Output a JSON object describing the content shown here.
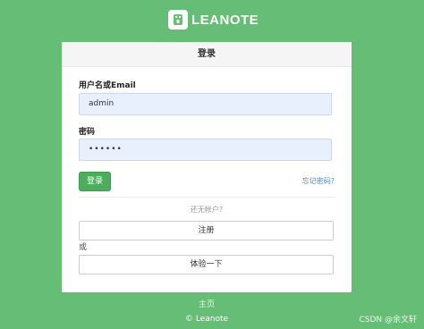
{
  "brand": {
    "logo_text": "LEANOTE",
    "logo_icon": "leanote-logo-icon"
  },
  "login_card": {
    "title": "登录",
    "username_label": "用户名或Email",
    "username_value": "admin",
    "password_label": "密码",
    "password_value": "••••••",
    "login_button": "登录",
    "forgot_link": "忘记密码?",
    "no_account_text": "还无帐户?",
    "register_button": "注册",
    "or_text": "或",
    "trial_button": "体验一下"
  },
  "footer": {
    "home_link": "主页",
    "copyright": "© Leanote"
  },
  "watermark": "CSDN @余文轩",
  "colors": {
    "background": "#66bd75",
    "primary_button": "#4cae5c",
    "input_fill": "#e8f0fe",
    "link": "#4a86c5"
  }
}
